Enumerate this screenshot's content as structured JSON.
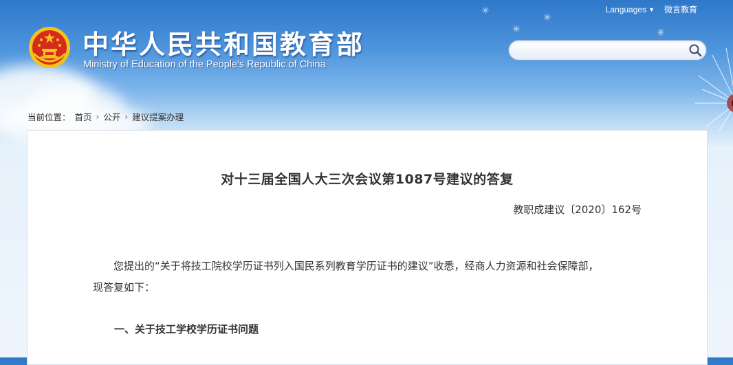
{
  "header": {
    "title_cn": "中华人民共和国教育部",
    "title_en": "Ministry of Education of the People's Republic of China",
    "languages_label": "Languages",
    "weiyan_label": "微言教育",
    "search_placeholder": ""
  },
  "breadcrumb": {
    "label": "当前位置：",
    "items": [
      "首页",
      "公开",
      "建议提案办理"
    ]
  },
  "document": {
    "title": "对十三届全国人大三次会议第1087号建议的答复",
    "number": "教职成建议〔2020〕162号",
    "paragraph_1a": "您提出的“关于将技工院校学历证书列入国民系列教育学历证书的建议”收悉，经商人力资源和社会保障部，",
    "paragraph_1b": "现答复如下：",
    "section_1": "一、关于技工学校学历证书问题"
  },
  "colors": {
    "sky_top": "#2f78c9",
    "sky_bottom": "#eef5fc",
    "emblem_red": "#d62a1f",
    "emblem_gold": "#f2c318",
    "text": "#333333"
  }
}
